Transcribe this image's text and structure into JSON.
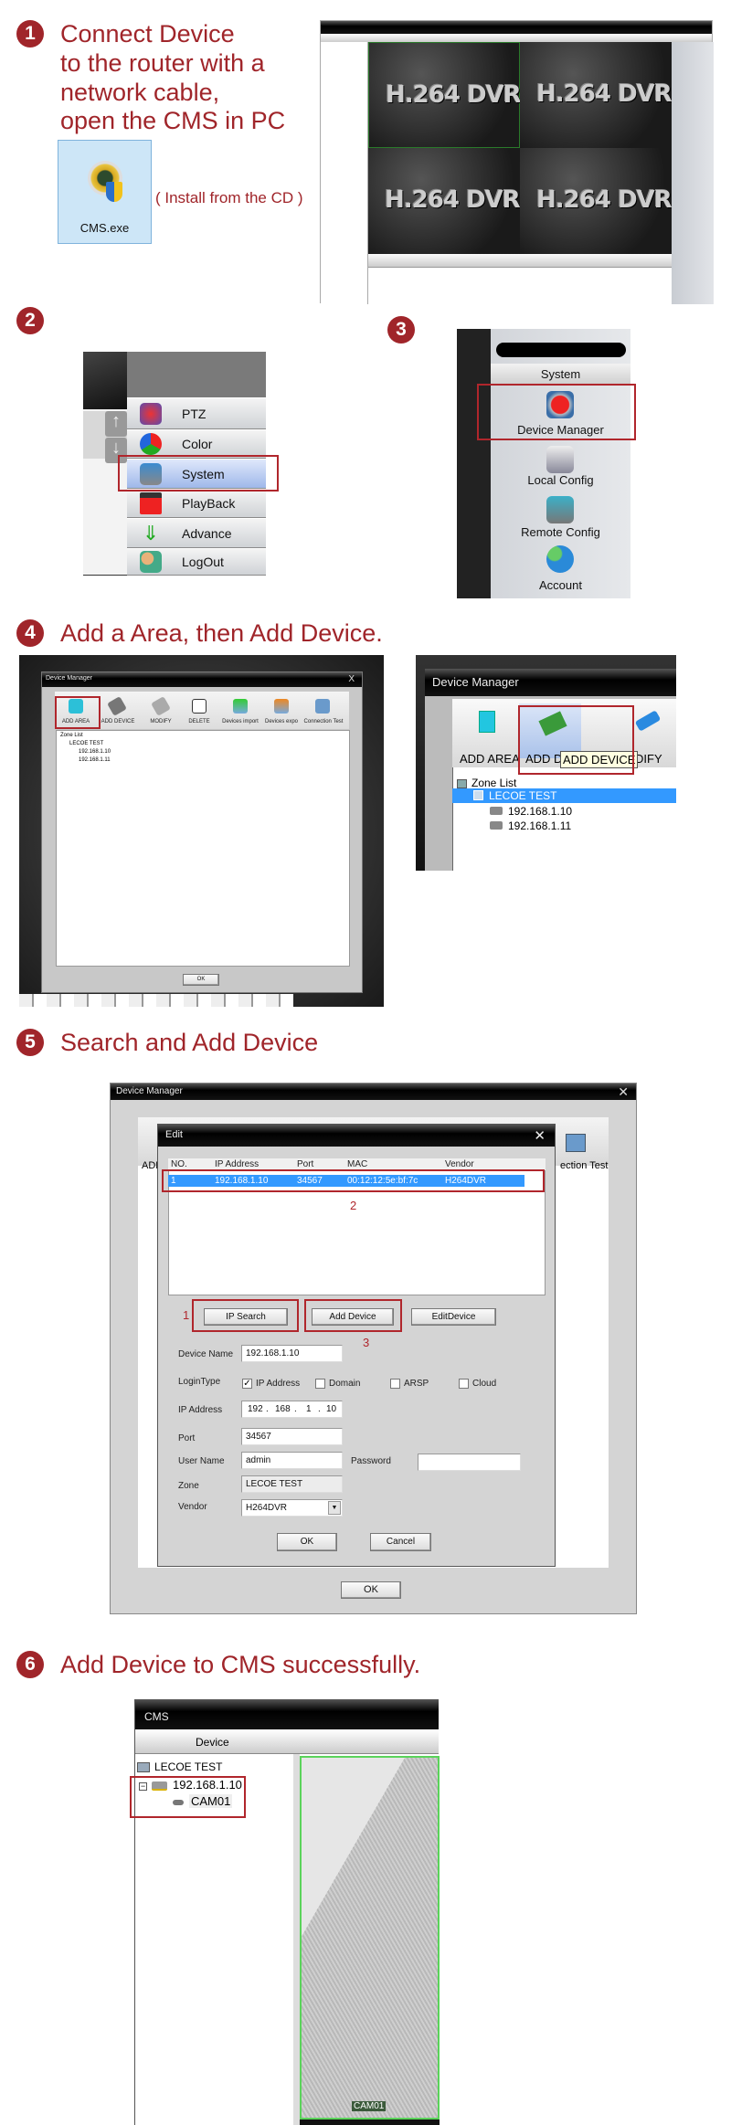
{
  "colors": {
    "accent": "#a0252a",
    "selection": "#3399ff",
    "highlight_box": "#b0262c"
  },
  "step1": {
    "number": "1",
    "lines": [
      "Connect Device",
      "to the router with a",
      "network cable,",
      "open the CMS in PC"
    ],
    "file_icon": {
      "icon": "cms-camera-icon",
      "label": "CMS.exe"
    },
    "note": "( Install from the CD )",
    "screenshot": {
      "quad_text": "H.264 DVR"
    }
  },
  "step2": {
    "number": "2",
    "menu": [
      {
        "label": "PTZ",
        "icon": "ptz-icon"
      },
      {
        "label": "Color",
        "icon": "color-icon"
      },
      {
        "label": "System",
        "icon": "system-icon",
        "highlighted": true
      },
      {
        "label": "PlayBack",
        "icon": "playback-icon"
      },
      {
        "label": "Advance",
        "icon": "advance-icon"
      },
      {
        "label": "LogOut",
        "icon": "logout-icon"
      }
    ]
  },
  "step3": {
    "number": "3",
    "header": "System",
    "items": [
      {
        "label": "Device Manager",
        "icon": "device-manager-icon",
        "highlighted": true
      },
      {
        "label": "Local Config",
        "icon": "local-config-icon"
      },
      {
        "label": "Remote Config",
        "icon": "remote-config-icon"
      },
      {
        "label": "Account",
        "icon": "account-icon"
      }
    ]
  },
  "step4": {
    "number": "4",
    "heading": "Add a Area, then Add Device.",
    "left": {
      "title": "Device Manager",
      "close": "X",
      "toolbar": [
        "ADD AREA",
        "ADD DEVICE",
        "MODIFY",
        "DELETE",
        "Devices import",
        "Devices expo",
        "Connection Test"
      ],
      "tree": {
        "root": "Zone List",
        "zone": "LECOE TEST",
        "devices": [
          "192.168.1.10",
          "192.168.1.11"
        ]
      },
      "ok": "OK"
    },
    "right": {
      "title": "Device Manager",
      "toolbar": [
        "ADD AREA",
        "ADD D",
        "DIFY"
      ],
      "tooltip": "ADD DEVICE",
      "tree": {
        "root": "Zone List",
        "zone": "LECOE TEST",
        "devices": [
          "192.168.1.10",
          "192.168.1.11"
        ]
      }
    }
  },
  "step5": {
    "number": "5",
    "heading": "Search and Add Device",
    "outer": {
      "title": "Device Manager",
      "close": "✕",
      "toolbar_left": "ADD",
      "toolbar_right": "ection Test",
      "ok": "OK"
    },
    "edit": {
      "title": "Edit",
      "close": "✕",
      "columns": [
        "NO.",
        "IP Address",
        "Port",
        "MAC",
        "Vendor"
      ],
      "rows": [
        [
          "1",
          "192.168.1.10",
          "34567",
          "00:12:12:5e:bf:7c",
          "H264DVR"
        ]
      ],
      "markers": [
        "1",
        "2",
        "3"
      ],
      "buttons": {
        "ip_search": "IP Search",
        "add_device": "Add Device",
        "edit_device": "EditDevice",
        "ok": "OK",
        "cancel": "Cancel"
      },
      "fields": {
        "device_name": {
          "label": "Device Name",
          "value": "192.168.1.10"
        },
        "login_type": {
          "label": "LoginType",
          "options": [
            {
              "label": "IP Address",
              "checked": true
            },
            {
              "label": "Domain",
              "checked": false
            },
            {
              "label": "ARSP",
              "checked": false
            },
            {
              "label": "Cloud",
              "checked": false
            }
          ]
        },
        "ip_address": {
          "label": "IP Address",
          "octets": [
            "192",
            "168",
            "1",
            "10"
          ]
        },
        "port": {
          "label": "Port",
          "value": "34567"
        },
        "user_name": {
          "label": "User Name",
          "value": "admin"
        },
        "password": {
          "label": "Password",
          "value": ""
        },
        "zone": {
          "label": "Zone",
          "value": "LECOE TEST"
        },
        "vendor": {
          "label": "Vendor",
          "value": "H264DVR"
        }
      }
    }
  },
  "step6": {
    "number": "6",
    "heading": "Add Device to CMS successfully.",
    "window": {
      "title": "CMS",
      "tab": "Device",
      "tree": {
        "zone": "LECOE TEST",
        "device": "192.168.1.10",
        "expander": "−",
        "camera": "CAM01"
      },
      "video_label": "CAM01"
    }
  }
}
